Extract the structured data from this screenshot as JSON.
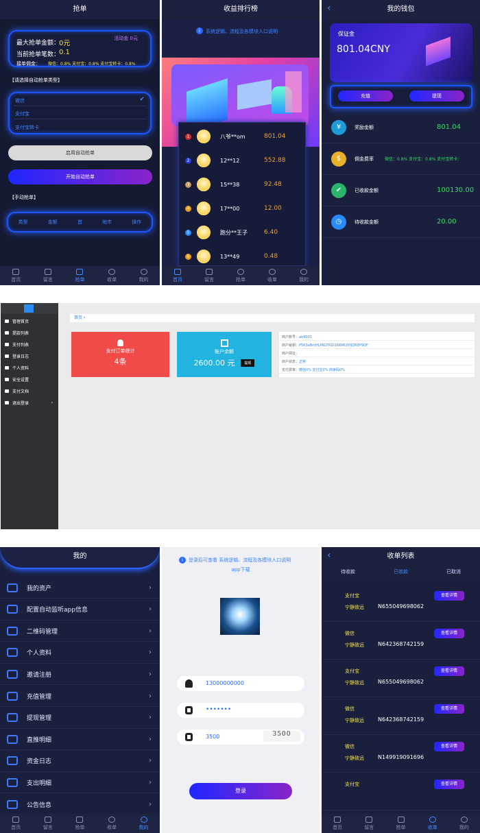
{
  "screen1": {
    "title": "抢单",
    "max_amount_label": "最大抢单金额：",
    "max_amount_value": "0元",
    "activity_badge": "活动金 0元",
    "count_label": "当前抢单笔数：",
    "count_value": "0.1",
    "commission_label": "接单佣金：",
    "commission_value": "微信：0.8% 支付宝：0.8% 支付宝转卡：0.8%",
    "select_title": "【请选择自动抢单类型】",
    "types": [
      "微信",
      "支付宝",
      "支付宝转卡"
    ],
    "check_mark": "✔",
    "enable_btn": "启用自动抢单",
    "start_btn": "开始自动抢单",
    "manual_title": "【手动抢单】",
    "table_headers": [
      "类型",
      "金额",
      "首",
      "地市",
      "操作"
    ],
    "tabs": [
      "首页",
      "留言",
      "抢单",
      "收单",
      "我的"
    ]
  },
  "screen2": {
    "title": "收益排行榜",
    "notice": "系统逻辑、流程及各模块入口说明",
    "rows": [
      {
        "rank": "1",
        "name": "八爷**om",
        "amount": "801.04"
      },
      {
        "rank": "2",
        "name": "12**12",
        "amount": "552.88"
      },
      {
        "rank": "3",
        "name": "15**38",
        "amount": "92.48"
      },
      {
        "rank": "4",
        "name": "17**00",
        "amount": "12.00"
      },
      {
        "rank": "5",
        "name": "跑分**王子",
        "amount": "6.40"
      },
      {
        "rank": "6",
        "name": "13**49",
        "amount": "0.48"
      }
    ],
    "rank_colors": [
      "#e02a2a",
      "#2a3fd9",
      "#c89a6a",
      "#e89a20",
      "#2a8bff",
      "#e89a20"
    ],
    "tabs": [
      "首页",
      "留言",
      "抢单",
      "收单",
      "我的"
    ]
  },
  "screen3": {
    "title": "我的钱包",
    "back": "‹",
    "deposit_label": "保证金",
    "deposit_value": "801.04CNY",
    "recharge_btn": "充值",
    "withdraw_btn": "提现",
    "items": [
      {
        "label": "奖励金额",
        "value": "801.04",
        "icon": "¥",
        "color": "#1e9bd7"
      },
      {
        "label": "佣金费率",
        "value": "微信：0.8% 支付宝：0.8% 支付宝转卡：",
        "icon": "$",
        "color": "#e8b02a"
      },
      {
        "label": "已收款金额",
        "value": "100130.00",
        "icon": "✔",
        "color": "#2ab56a"
      },
      {
        "label": "待收款金额",
        "value": "20.00",
        "icon": "◷",
        "color": "#2a8bff"
      }
    ]
  },
  "admin": {
    "sidebar": [
      "管理首页",
      "提款列表",
      "支付列表",
      "登录日志",
      "个人资料",
      "安全设置",
      "支付文档",
      "退出登录"
    ],
    "breadcrumb": "首页",
    "card1_title": "支付订单统计",
    "card1_value": "4条",
    "card2_title": "账户余额",
    "card2_value": "2600.00 元",
    "card2_btn": "提现",
    "info": [
      {
        "k": "商户账号：",
        "v": "ab9001"
      },
      {
        "k": "商户秘钥：",
        "v": "P5K3aBmHLPKCFRDI1N6MLNYJQR8P9OF"
      },
      {
        "k": "商户网址：",
        "v": ""
      },
      {
        "k": "商户状态：",
        "v": "正常"
      },
      {
        "k": "支付费率：",
        "v": "微信0% 支付宝0% 商家码0%"
      }
    ],
    "colors": {
      "card1": "#f04b48",
      "card2": "#22b3e0",
      "sidebar": "#2f3033"
    }
  },
  "screen4": {
    "title": "我的",
    "menu": [
      "我的资产",
      "配置自动监听app信息",
      "二维码管理",
      "个人资料",
      "邀请注册",
      "充值管理",
      "提现管理",
      "直推明细",
      "资金日志",
      "支出明细",
      "公告信息"
    ],
    "tabs": [
      "首页",
      "留言",
      "抢单",
      "收单",
      "我的"
    ]
  },
  "screen5": {
    "notice": "登录后可查看 系统逻辑、流程及各模块入口说明",
    "app_download": "app下载",
    "phone": "13000000000",
    "password": "•••••••",
    "captcha_input": "3500",
    "captcha_image": "3500",
    "login_btn": "登录"
  },
  "screen6": {
    "title": "收单列表",
    "back": "‹",
    "tabs": [
      "待收款",
      "已收款",
      "已取消"
    ],
    "orders": [
      {
        "channel": "支付宝",
        "name": "宁静致远",
        "order": "N655049698062",
        "btn": "查看详情"
      },
      {
        "channel": "微信",
        "name": "宁静致远",
        "order": "N642368742159",
        "btn": "查看详情"
      },
      {
        "channel": "支付宝",
        "name": "宁静致远",
        "order": "N655049698062",
        "btn": "查看详情"
      },
      {
        "channel": "微信",
        "name": "宁静致远",
        "order": "N642368742159",
        "btn": "查看详情"
      },
      {
        "channel": "微信",
        "name": "宁静致远",
        "order": "N149919091696",
        "btn": "查看详情"
      },
      {
        "channel": "支付宝",
        "name": "",
        "order": "",
        "btn": "查看详情"
      }
    ],
    "bottom_tabs": [
      "首页",
      "留言",
      "抢单",
      "收单",
      "我的"
    ]
  }
}
